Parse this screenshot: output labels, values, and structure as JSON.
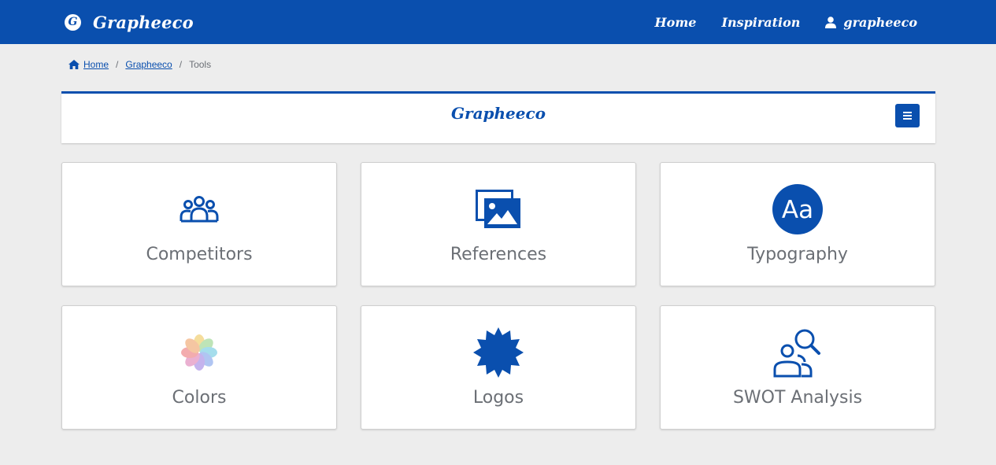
{
  "navbar": {
    "brand_logo_letter": "G",
    "brand_name": "Grapheeco",
    "links": [
      {
        "label": "Home"
      },
      {
        "label": "Inspiration"
      },
      {
        "label": "grapheeco",
        "icon": "user-icon"
      }
    ]
  },
  "breadcrumb": {
    "items": [
      {
        "label": "Home",
        "icon": "home-icon"
      },
      {
        "label": "Grapheeco"
      },
      {
        "label": "Tools"
      }
    ],
    "separator": "/"
  },
  "project_bar": {
    "title": "Grapheeco",
    "menu_icon": "hamburger-icon"
  },
  "tools": [
    {
      "label": "Competitors",
      "icon": "users-group-icon"
    },
    {
      "label": "References",
      "icon": "images-icon"
    },
    {
      "label": "Typography",
      "icon": "typography-icon",
      "icon_text": "Aa"
    },
    {
      "label": "Colors",
      "icon": "color-palette-icon"
    },
    {
      "label": "Logos",
      "icon": "badge-icon"
    },
    {
      "label": "SWOT Analysis",
      "icon": "user-search-icon"
    }
  ],
  "colors": {
    "primary": "#0a4fae",
    "background": "#ededed",
    "text": "#6b6f75"
  }
}
